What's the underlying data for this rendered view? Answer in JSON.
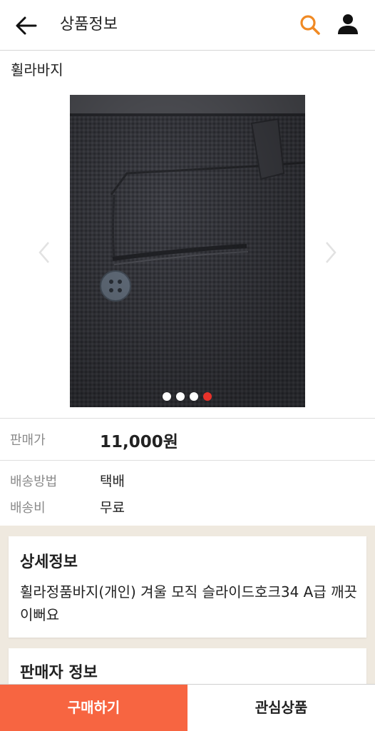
{
  "header": {
    "title": "상품정보",
    "back_icon": "arrow-left-icon",
    "search_icon": "search-icon",
    "user_icon": "user-icon",
    "search_color": "#f08a24"
  },
  "product": {
    "name": "휠라바지",
    "image": {
      "description_icon": "product-photo",
      "dots_total": 4,
      "active_dot": 4
    },
    "price_label": "판매가",
    "price": "11,000원",
    "shipping_method_label": "배송방법",
    "shipping_method": "택배",
    "shipping_fee_label": "배송비",
    "shipping_fee": "무료"
  },
  "detail": {
    "heading": "상세정보",
    "text": "휠라정품바지(개인) 겨울 모직 슬라이드호크34 A급 깨끗이뻐요"
  },
  "seller": {
    "heading": "판매자 정보"
  },
  "bottom_bar": {
    "buy_label": "구매하기",
    "wish_label": "관심상품",
    "buy_color": "#f76541"
  }
}
